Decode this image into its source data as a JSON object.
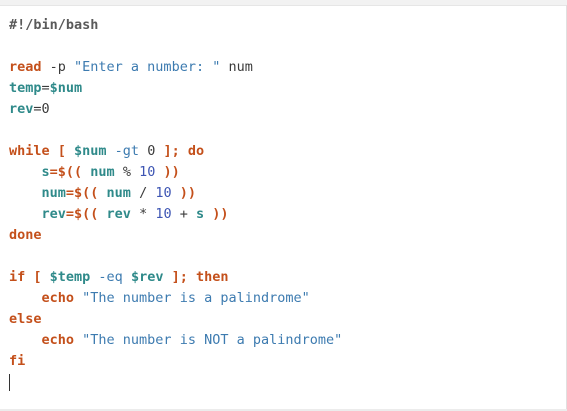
{
  "editor": {
    "lines": {
      "l1": {
        "shebang": "#!/bin/bash"
      },
      "l3": {
        "kw": "read",
        "opt": " -p ",
        "str": "\"Enter a number: \"",
        "arg": " num"
      },
      "l4": {
        "var": "temp",
        "eq": "=",
        "val": "$num"
      },
      "l5": {
        "var": "rev",
        "eq": "=",
        "num": "0"
      },
      "l7": {
        "kw1": "while",
        "b1": " [ ",
        "var": "$num",
        "op": " -gt ",
        "num": "0",
        "b2": " ]; ",
        "kw2": "do"
      },
      "l8": {
        "indent": "    ",
        "var": "s",
        "b1": "=$(( ",
        "var2": "num",
        "op": " % ",
        "num": "10",
        "b2": " ))"
      },
      "l9": {
        "indent": "    ",
        "var": "num",
        "b1": "=$(( ",
        "var2": "num",
        "op": " / ",
        "num": "10",
        "b2": " ))"
      },
      "l10": {
        "indent": "    ",
        "var": "rev",
        "b1": "=$(( ",
        "var2": "rev",
        "op": " * ",
        "num": "10",
        "plus": " + ",
        "var3": "s",
        "b2": " ))"
      },
      "l11": {
        "kw": "done"
      },
      "l13": {
        "kw1": "if",
        "b1": " [ ",
        "var": "$temp",
        "op": " -eq ",
        "var2": "$rev",
        "b2": " ]; ",
        "kw2": "then"
      },
      "l14": {
        "indent": "    ",
        "kw": "echo",
        "str": " \"The number is a palindrome\""
      },
      "l15": {
        "kw": "else"
      },
      "l16": {
        "indent": "    ",
        "kw": "echo",
        "str": " \"The number is NOT a palindrome\""
      },
      "l17": {
        "kw": "fi"
      }
    }
  }
}
